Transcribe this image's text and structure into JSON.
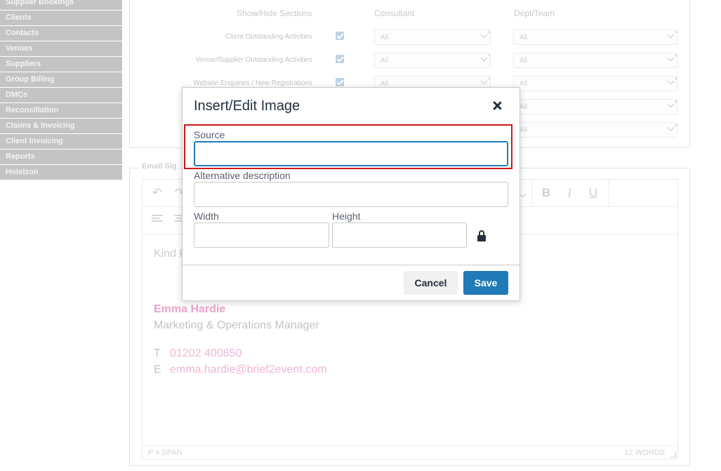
{
  "sidebar": {
    "items": [
      {
        "label": "Supplier Bookings"
      },
      {
        "label": "Clients"
      },
      {
        "label": "Contacts"
      },
      {
        "label": "Venues"
      },
      {
        "label": "Suppliers"
      },
      {
        "label": "Group Billing"
      },
      {
        "label": "DMCs"
      },
      {
        "label": "Reconciliation"
      },
      {
        "label": "Claims & Invoicing"
      },
      {
        "label": "Client Invoicing"
      },
      {
        "label": "Reports"
      },
      {
        "label": "Hotelzon"
      }
    ]
  },
  "sections": {
    "headers": {
      "show_hide": "Show/Hide Sections",
      "consultant": "Consultant",
      "dept_team": "Dept/Team"
    },
    "rows": [
      {
        "label": "Client Outstanding Activities",
        "checked": true,
        "consultant": "All",
        "dept": "All"
      },
      {
        "label": "Venue/Supplier Outstanding Activities",
        "checked": true,
        "consultant": "All",
        "dept": "All"
      },
      {
        "label": "Website Enquiries / New Registrations",
        "checked": true,
        "consultant": "All",
        "dept": "All"
      },
      {
        "label": "",
        "checked": false,
        "consultant": "",
        "dept": "All"
      },
      {
        "label": "",
        "checked": false,
        "consultant": "",
        "dept": "All"
      }
    ]
  },
  "signature": {
    "legend": "Email Sig",
    "greeting": "Kind R",
    "name": "Emma Hardie",
    "title": "Marketing & Operations Manager",
    "phone_prefix": "T",
    "phone": "01202 400850",
    "email_prefix": "E",
    "email": "emma.hardie@brief2event.com",
    "status_path": "P » SPAN",
    "word_count": "12 WORDS"
  },
  "toolbar": {
    "undo_icon": "↶",
    "redo_icon": "↷",
    "bold": "B",
    "italic": "I",
    "underline": "U"
  },
  "dialog": {
    "title": "Insert/Edit Image",
    "source_label": "Source",
    "source_value": "",
    "alt_label": "Alternative description",
    "alt_value": "",
    "width_label": "Width",
    "width_value": "",
    "height_label": "Height",
    "height_value": "",
    "cancel_label": "Cancel",
    "save_label": "Save"
  },
  "colors": {
    "accent": "#207ab7",
    "highlight": "#d0151d",
    "signature_pink": "#e8a3c8",
    "sidebar_bg": "#c4c4c4"
  }
}
